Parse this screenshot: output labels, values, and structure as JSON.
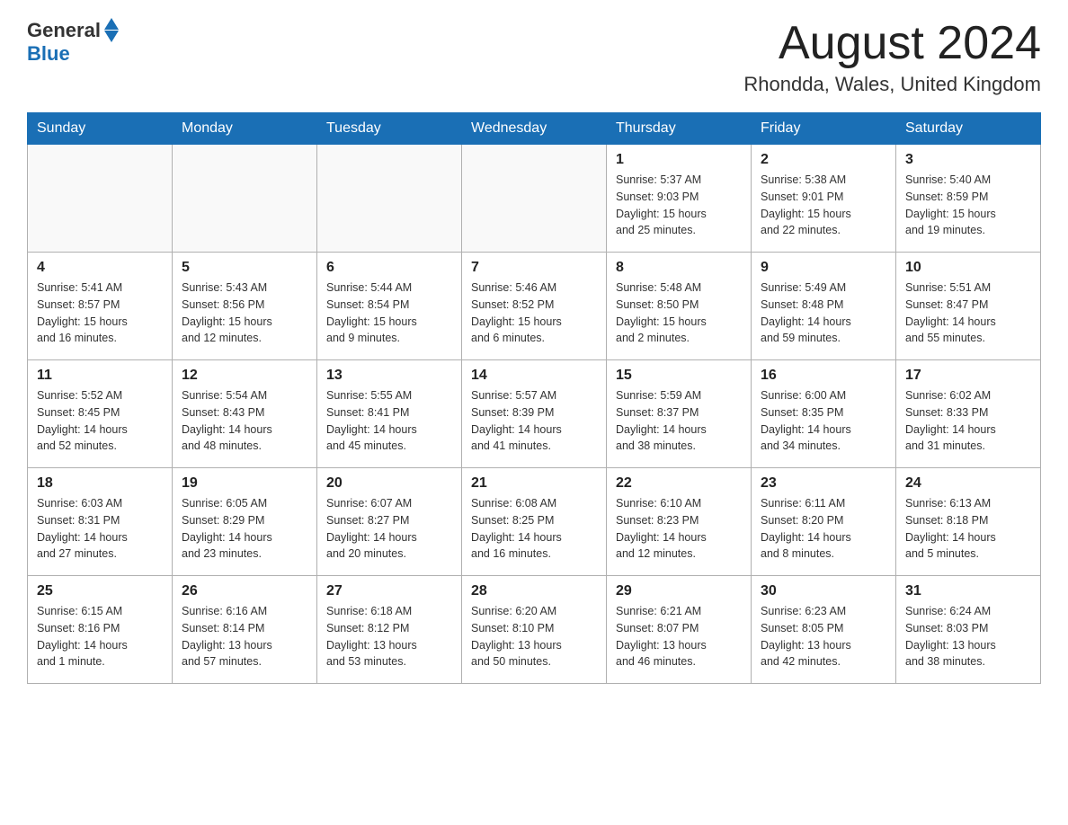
{
  "header": {
    "logo_general": "General",
    "logo_blue": "Blue",
    "month": "August 2024",
    "location": "Rhondda, Wales, United Kingdom"
  },
  "days_of_week": [
    "Sunday",
    "Monday",
    "Tuesday",
    "Wednesday",
    "Thursday",
    "Friday",
    "Saturday"
  ],
  "weeks": [
    [
      {
        "day": "",
        "info": ""
      },
      {
        "day": "",
        "info": ""
      },
      {
        "day": "",
        "info": ""
      },
      {
        "day": "",
        "info": ""
      },
      {
        "day": "1",
        "info": "Sunrise: 5:37 AM\nSunset: 9:03 PM\nDaylight: 15 hours\nand 25 minutes."
      },
      {
        "day": "2",
        "info": "Sunrise: 5:38 AM\nSunset: 9:01 PM\nDaylight: 15 hours\nand 22 minutes."
      },
      {
        "day": "3",
        "info": "Sunrise: 5:40 AM\nSunset: 8:59 PM\nDaylight: 15 hours\nand 19 minutes."
      }
    ],
    [
      {
        "day": "4",
        "info": "Sunrise: 5:41 AM\nSunset: 8:57 PM\nDaylight: 15 hours\nand 16 minutes."
      },
      {
        "day": "5",
        "info": "Sunrise: 5:43 AM\nSunset: 8:56 PM\nDaylight: 15 hours\nand 12 minutes."
      },
      {
        "day": "6",
        "info": "Sunrise: 5:44 AM\nSunset: 8:54 PM\nDaylight: 15 hours\nand 9 minutes."
      },
      {
        "day": "7",
        "info": "Sunrise: 5:46 AM\nSunset: 8:52 PM\nDaylight: 15 hours\nand 6 minutes."
      },
      {
        "day": "8",
        "info": "Sunrise: 5:48 AM\nSunset: 8:50 PM\nDaylight: 15 hours\nand 2 minutes."
      },
      {
        "day": "9",
        "info": "Sunrise: 5:49 AM\nSunset: 8:48 PM\nDaylight: 14 hours\nand 59 minutes."
      },
      {
        "day": "10",
        "info": "Sunrise: 5:51 AM\nSunset: 8:47 PM\nDaylight: 14 hours\nand 55 minutes."
      }
    ],
    [
      {
        "day": "11",
        "info": "Sunrise: 5:52 AM\nSunset: 8:45 PM\nDaylight: 14 hours\nand 52 minutes."
      },
      {
        "day": "12",
        "info": "Sunrise: 5:54 AM\nSunset: 8:43 PM\nDaylight: 14 hours\nand 48 minutes."
      },
      {
        "day": "13",
        "info": "Sunrise: 5:55 AM\nSunset: 8:41 PM\nDaylight: 14 hours\nand 45 minutes."
      },
      {
        "day": "14",
        "info": "Sunrise: 5:57 AM\nSunset: 8:39 PM\nDaylight: 14 hours\nand 41 minutes."
      },
      {
        "day": "15",
        "info": "Sunrise: 5:59 AM\nSunset: 8:37 PM\nDaylight: 14 hours\nand 38 minutes."
      },
      {
        "day": "16",
        "info": "Sunrise: 6:00 AM\nSunset: 8:35 PM\nDaylight: 14 hours\nand 34 minutes."
      },
      {
        "day": "17",
        "info": "Sunrise: 6:02 AM\nSunset: 8:33 PM\nDaylight: 14 hours\nand 31 minutes."
      }
    ],
    [
      {
        "day": "18",
        "info": "Sunrise: 6:03 AM\nSunset: 8:31 PM\nDaylight: 14 hours\nand 27 minutes."
      },
      {
        "day": "19",
        "info": "Sunrise: 6:05 AM\nSunset: 8:29 PM\nDaylight: 14 hours\nand 23 minutes."
      },
      {
        "day": "20",
        "info": "Sunrise: 6:07 AM\nSunset: 8:27 PM\nDaylight: 14 hours\nand 20 minutes."
      },
      {
        "day": "21",
        "info": "Sunrise: 6:08 AM\nSunset: 8:25 PM\nDaylight: 14 hours\nand 16 minutes."
      },
      {
        "day": "22",
        "info": "Sunrise: 6:10 AM\nSunset: 8:23 PM\nDaylight: 14 hours\nand 12 minutes."
      },
      {
        "day": "23",
        "info": "Sunrise: 6:11 AM\nSunset: 8:20 PM\nDaylight: 14 hours\nand 8 minutes."
      },
      {
        "day": "24",
        "info": "Sunrise: 6:13 AM\nSunset: 8:18 PM\nDaylight: 14 hours\nand 5 minutes."
      }
    ],
    [
      {
        "day": "25",
        "info": "Sunrise: 6:15 AM\nSunset: 8:16 PM\nDaylight: 14 hours\nand 1 minute."
      },
      {
        "day": "26",
        "info": "Sunrise: 6:16 AM\nSunset: 8:14 PM\nDaylight: 13 hours\nand 57 minutes."
      },
      {
        "day": "27",
        "info": "Sunrise: 6:18 AM\nSunset: 8:12 PM\nDaylight: 13 hours\nand 53 minutes."
      },
      {
        "day": "28",
        "info": "Sunrise: 6:20 AM\nSunset: 8:10 PM\nDaylight: 13 hours\nand 50 minutes."
      },
      {
        "day": "29",
        "info": "Sunrise: 6:21 AM\nSunset: 8:07 PM\nDaylight: 13 hours\nand 46 minutes."
      },
      {
        "day": "30",
        "info": "Sunrise: 6:23 AM\nSunset: 8:05 PM\nDaylight: 13 hours\nand 42 minutes."
      },
      {
        "day": "31",
        "info": "Sunrise: 6:24 AM\nSunset: 8:03 PM\nDaylight: 13 hours\nand 38 minutes."
      }
    ]
  ],
  "colors": {
    "header_bg": "#1a6fb5",
    "header_text": "#ffffff",
    "border": "#b0b0b0"
  }
}
